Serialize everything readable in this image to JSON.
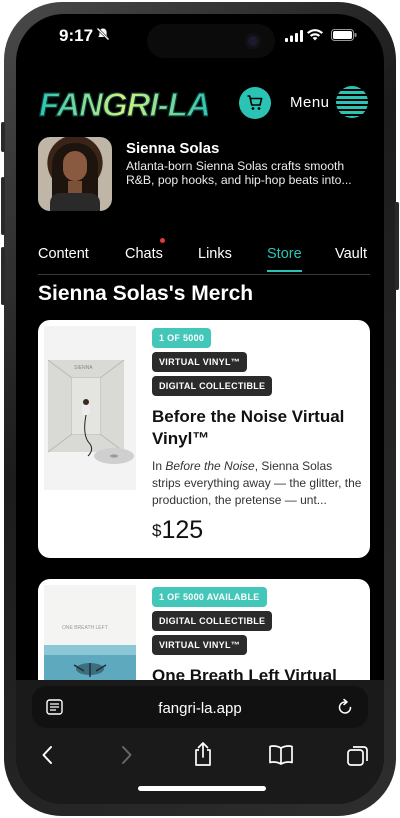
{
  "status": {
    "time": "9:17"
  },
  "header": {
    "logo_text": "FANGRI-LA",
    "menu_label": "Menu"
  },
  "profile": {
    "name": "Sienna Solas",
    "bio": "Atlanta-born Sienna Solas crafts smooth R&B, pop hooks, and hip-hop beats into..."
  },
  "tabs": [
    {
      "label": "Content",
      "active": false
    },
    {
      "label": "Chats",
      "active": false,
      "notify": true
    },
    {
      "label": "Links",
      "active": false
    },
    {
      "label": "Store",
      "active": true
    },
    {
      "label": "Vault",
      "active": false
    }
  ],
  "section_title": "Sienna Solas's Merch",
  "products": [
    {
      "badges": [
        {
          "text": "1 OF 5000",
          "style": "teal"
        },
        {
          "text": "VIRTUAL VINYL™",
          "style": "dark"
        },
        {
          "text": "DIGITAL COLLECTIBLE",
          "style": "dark"
        }
      ],
      "title": "Before the Noise Virtual Vinyl™",
      "desc_prefix": "In ",
      "desc_italic": "Before the Noise",
      "desc_rest": ", Sienna Solas strips everything away — the glitter, the production, the pretense — unt...",
      "currency": "$",
      "price": "125"
    },
    {
      "badges": [
        {
          "text": "1 OF 5000 AVAILABLE",
          "style": "teal"
        },
        {
          "text": "DIGITAL COLLECTIBLE",
          "style": "dark"
        },
        {
          "text": "VIRTUAL VINYL™",
          "style": "dark"
        }
      ],
      "title": "One Breath Left Virtual"
    }
  ],
  "browser": {
    "url": "fangri-la.app"
  },
  "colors": {
    "accent": "#2bc4b4",
    "notify_dot": "#e53935",
    "background": "#000000"
  }
}
